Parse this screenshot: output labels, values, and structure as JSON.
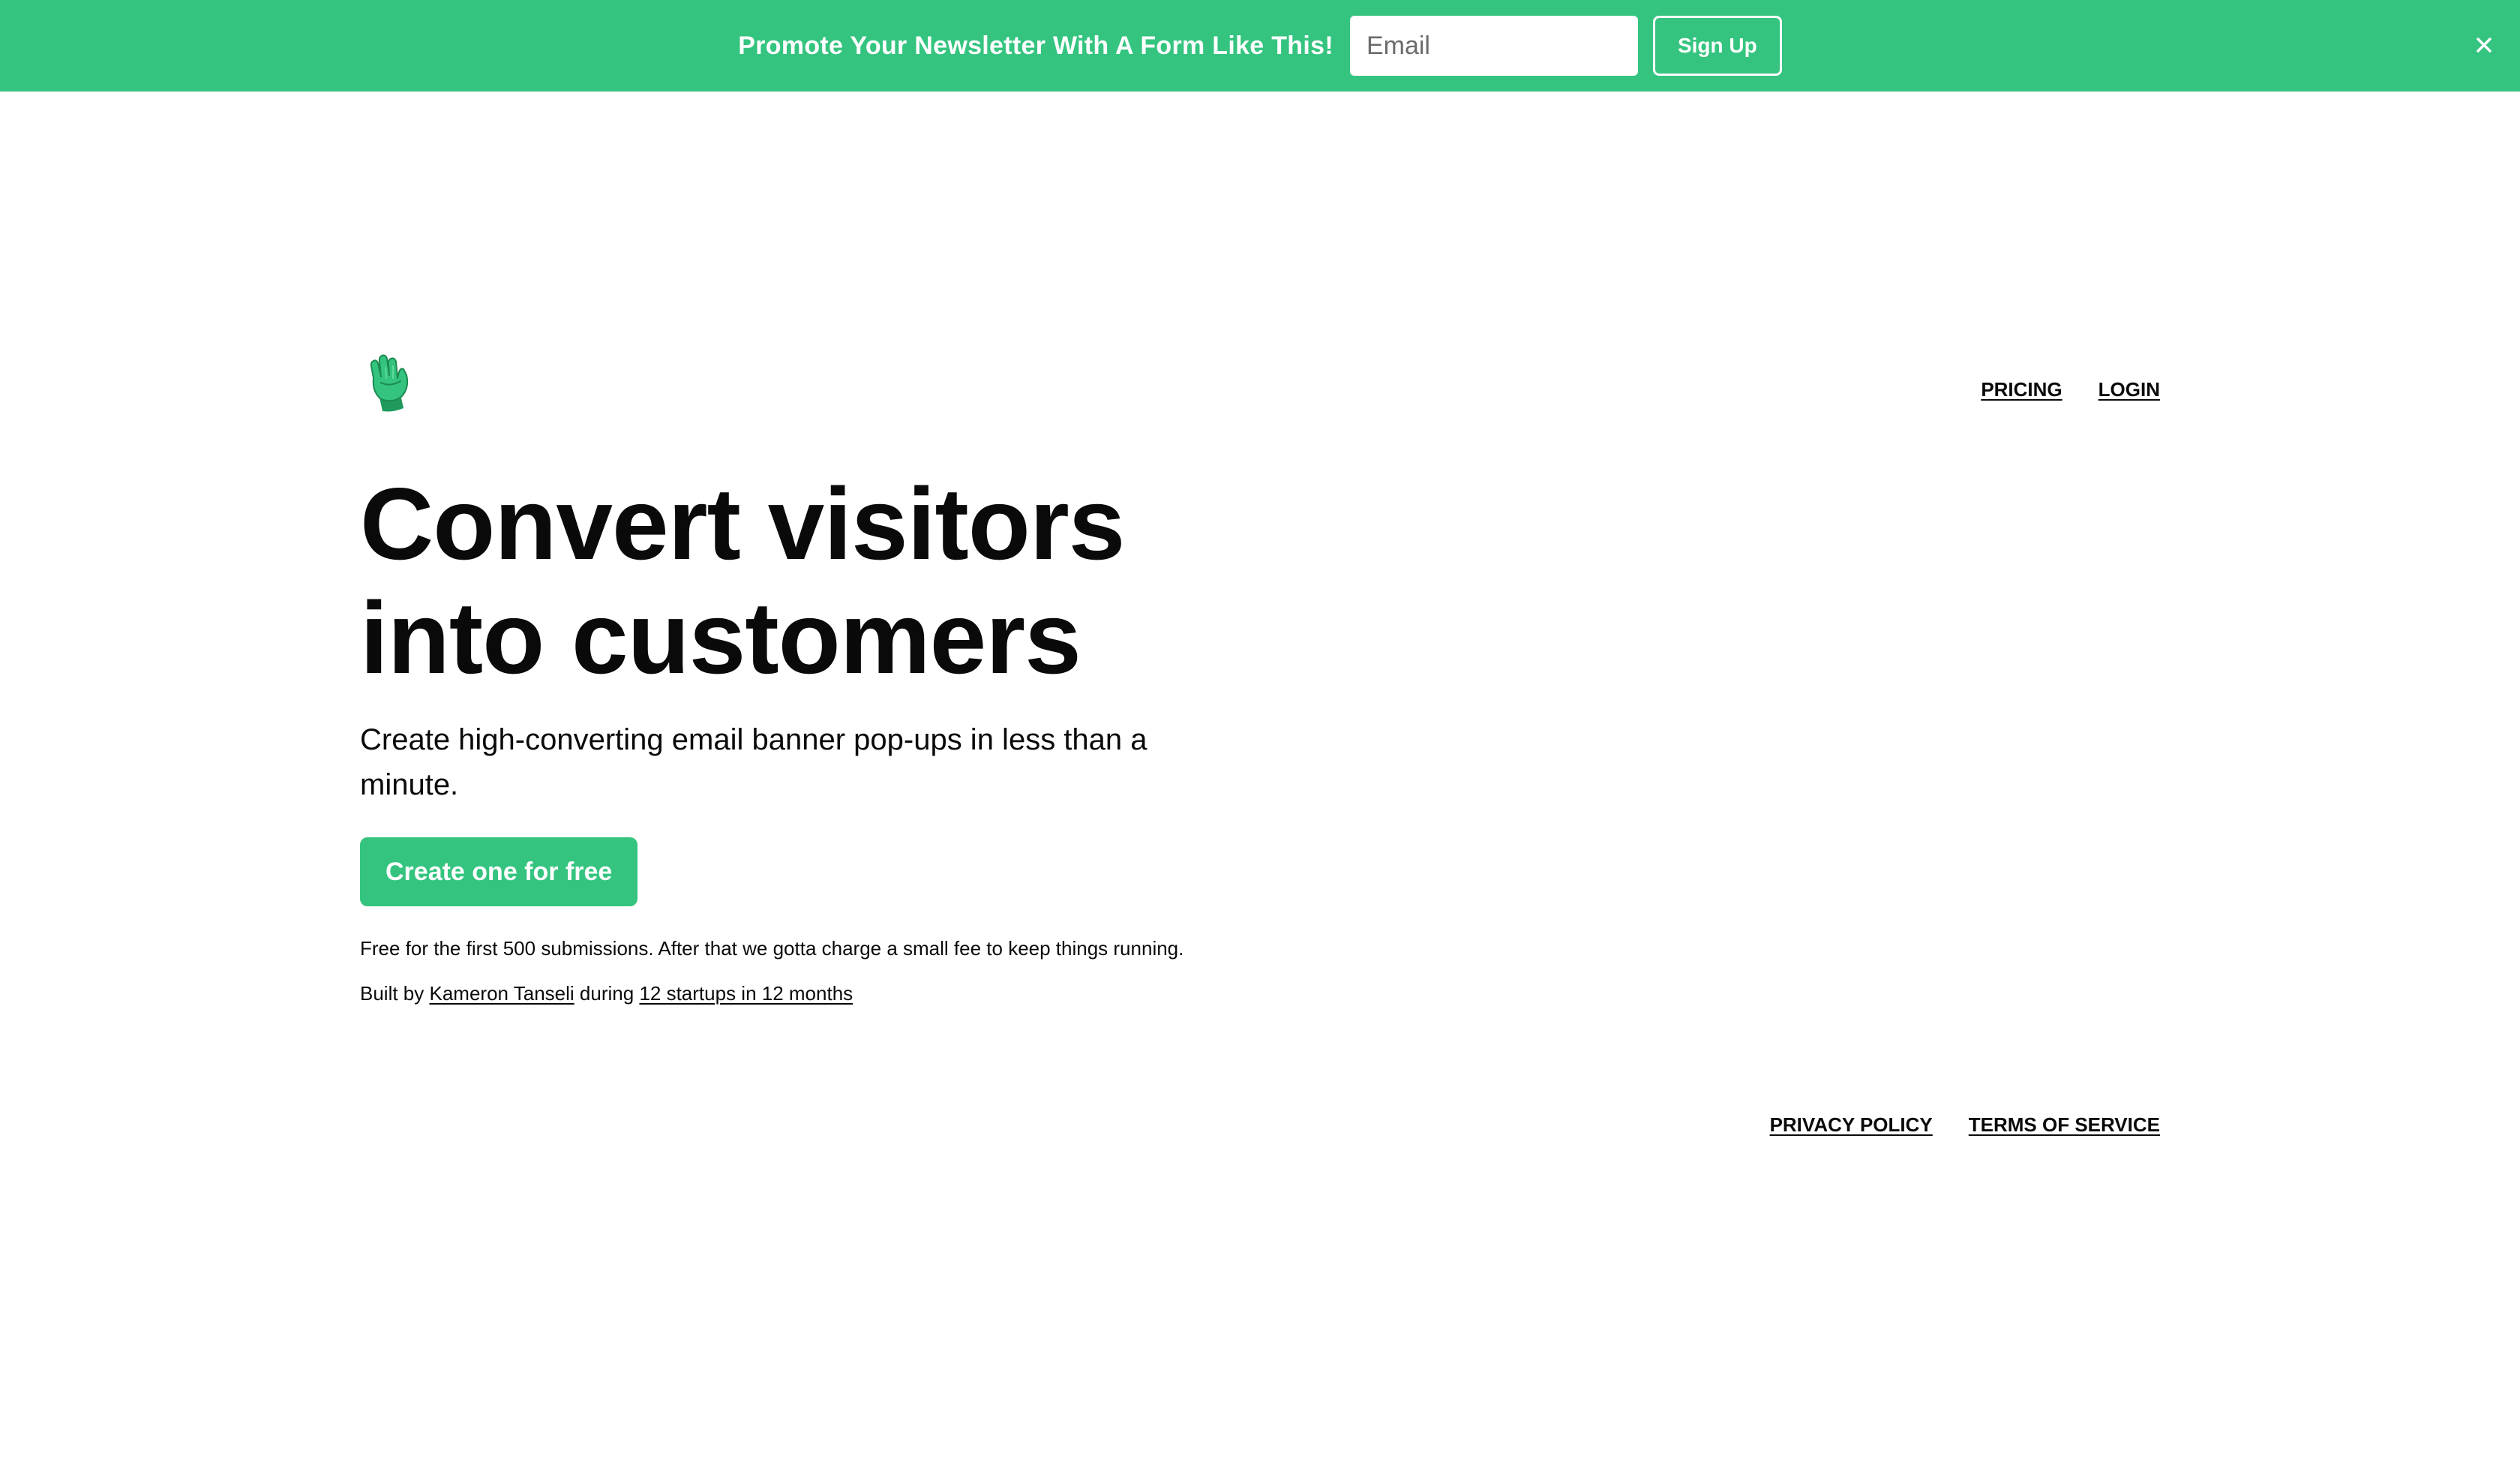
{
  "banner": {
    "message": "Promote Your Newsletter With A Form Like This!",
    "email_placeholder": "Email",
    "email_value": "",
    "signup_label": "Sign Up",
    "close_icon": "close-icon",
    "background_color": "#34c47f"
  },
  "header": {
    "logo_icon": "glove-hand-icon",
    "nav": {
      "pricing": "PRICING",
      "login": "LOGIN"
    }
  },
  "hero": {
    "title_line1": "Convert visitors",
    "title_line2": "into customers",
    "subtitle": "Create high-converting email banner pop-ups in less than a minute.",
    "cta_label": "Create one for free",
    "fineprint": "Free for the first 500 submissions. After that we gotta charge a small fee to keep things running.",
    "credits": {
      "prefix": "Built by",
      "author_link": "Kameron Tanseli",
      "middle": "during",
      "project_link": "12 startups in 12 months"
    }
  },
  "footer": {
    "privacy": "PRIVACY POLICY",
    "terms": "TERMS OF SERVICE"
  },
  "colors": {
    "accent": "#34c47f",
    "text": "#0a0a0a",
    "background": "#ffffff"
  }
}
